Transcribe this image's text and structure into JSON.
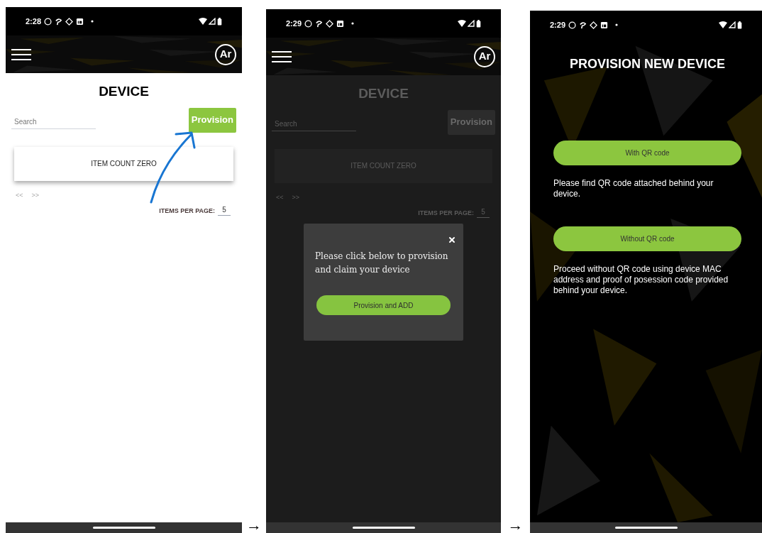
{
  "screens": [
    {
      "kind": "device_list",
      "dimmed": false,
      "annotation_arrow": true,
      "status_bar": {
        "time": "2:28"
      },
      "avatar": "Ar",
      "title": "DEVICE",
      "search": {
        "placeholder": "Search"
      },
      "provision_button": "Provision",
      "empty_message": "ITEM COUNT ZERO",
      "pager": {
        "prev": "<<",
        "next": ">>"
      },
      "items_per_page": {
        "label": "ITEMS PER PAGE:",
        "value": "5"
      }
    },
    {
      "kind": "device_list",
      "dimmed": true,
      "annotation_arrow": false,
      "status_bar": {
        "time": "2:29"
      },
      "avatar": "Ar",
      "title": "DEVICE",
      "search": {
        "placeholder": "Search"
      },
      "provision_button": "Provision",
      "empty_message": "ITEM COUNT ZERO",
      "pager": {
        "prev": "<<",
        "next": ">>"
      },
      "items_per_page": {
        "label": "ITEMS PER PAGE:",
        "value": "5"
      },
      "dialog": {
        "message": "Please click below to provision and claim your device",
        "button": "Provision and ADD"
      }
    },
    {
      "kind": "provision_options",
      "status_bar": {
        "time": "2:29"
      },
      "title": "PROVISION NEW DEVICE",
      "options": [
        {
          "button": "With QR code",
          "description": "Please find QR code attached behind your device."
        },
        {
          "button": "Without QR code",
          "description": "Proceed without QR code using device MAC address and proof of posession code provided behind your device."
        }
      ]
    }
  ],
  "transitions": [
    "→",
    "→"
  ]
}
